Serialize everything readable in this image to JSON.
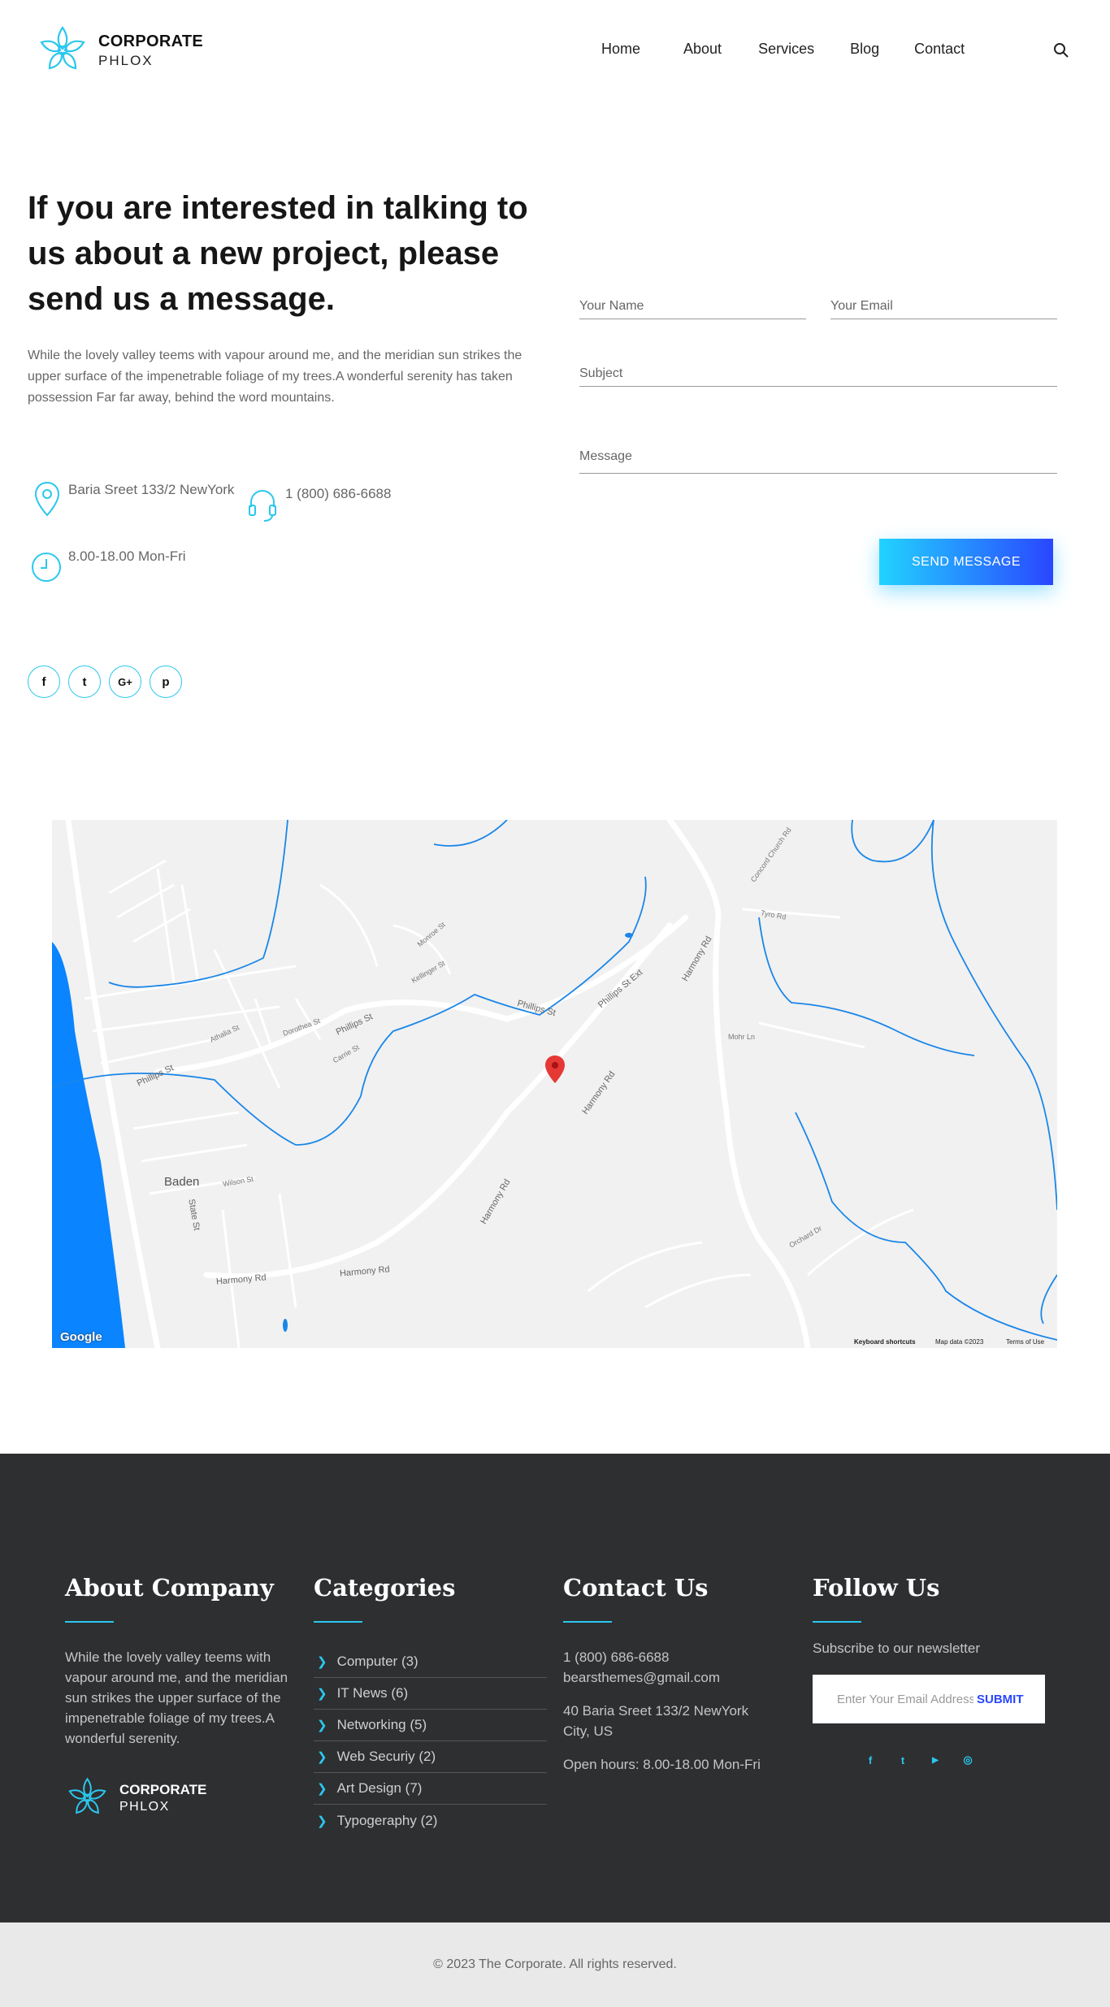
{
  "brand": {
    "line1": "CORPORATE",
    "line2": "PHLOX",
    "accent": "#2bc7ee",
    "accent2": "#2a46ff"
  },
  "nav": [
    {
      "label": "Home"
    },
    {
      "label": "About"
    },
    {
      "label": "Services"
    },
    {
      "label": "Blog"
    },
    {
      "label": "Contact"
    }
  ],
  "header": {
    "search_icon": "search-icon"
  },
  "hero": {
    "title": "If you are interested in talking to us about a new project, please send us a message.",
    "text": "While the lovely valley teems with vapour around me, and the meridian sun strikes the upper surface of the impenetrable foliage of my trees.A wonderful serenity has taken possession Far far away, behind the word mountains.",
    "address": "Baria Sreet 133/2 NewYork",
    "phone": "1 (800) 686-6688",
    "hours": "8.00-18.00 Mon-Fri"
  },
  "form": {
    "name": "Your Name",
    "email": "Your Email",
    "subject": "Subject",
    "message": "Message",
    "send": "SEND MESSAGE"
  },
  "social": [
    {
      "icon": "facebook-icon",
      "glyph": "f"
    },
    {
      "icon": "twitter-icon",
      "glyph": "t"
    },
    {
      "icon": "google-plus-icon",
      "glyph": "G+"
    },
    {
      "icon": "pinterest-icon",
      "glyph": "p"
    }
  ],
  "map": {
    "labels": {
      "baden": "Baden",
      "phillips": "Phillips St",
      "phillips2": "Phillips St",
      "phillips_ext": "Phillips St Ext",
      "harmony1": "Harmony Rd",
      "harmony2": "Harmony Rd",
      "harmony3": "Harmony Rd",
      "harmony4": "Harmony Rd",
      "harmony5": "Harmony Rd",
      "state": "State St",
      "wilson": "Wilson St",
      "dorothea": "Dorothea St",
      "carrie": "Carrie St",
      "athalia": "Athalia St",
      "kellinger": "Kellinger St",
      "monroe": "Monroe St",
      "mohr": "Mohr Ln",
      "orchard": "Orchard Dr",
      "concord": "Concord Church Rd",
      "tyro": "Tyro Rd"
    },
    "google": "Google",
    "shortcuts": "Keyboard shortcuts",
    "mapdata": "Map data ©2023",
    "terms": "Terms of Use",
    "pin_color": "#e53935",
    "water_color": "#0a84ff"
  },
  "footer": {
    "about": {
      "title": "About Company",
      "text": "While the lovely valley teems with vapour around me, and the meridian sun strikes the upper surface of the impenetrable foliage of my trees.A wonderful serenity."
    },
    "categories": {
      "title": "Categories",
      "items": [
        "Computer (3)",
        "IT News (6)",
        "Networking (5)",
        "Web Securiy (2)",
        "Art Design (7)",
        "Typogeraphy (2)"
      ]
    },
    "contact": {
      "title": "Contact Us",
      "phone": "1 (800) 686-6688",
      "email": "bearsthemes@gmail.com",
      "address": "40 Baria Sreet 133/2 NewYork City, US",
      "hours": "Open hours: 8.00-18.00 Mon-Fri"
    },
    "follow": {
      "title": "Follow Us",
      "subtitle": "Subscribe to our newsletter",
      "placeholder": "Enter Your Email Address",
      "submit": "SUBMIT",
      "icons": [
        {
          "icon": "facebook-icon",
          "glyph": "f"
        },
        {
          "icon": "twitter-icon",
          "glyph": "t"
        },
        {
          "icon": "youtube-icon",
          "glyph": "▶"
        },
        {
          "icon": "instagram-icon",
          "glyph": "◎"
        }
      ]
    }
  },
  "copyright": "© 2023 The Corporate. All rights reserved."
}
